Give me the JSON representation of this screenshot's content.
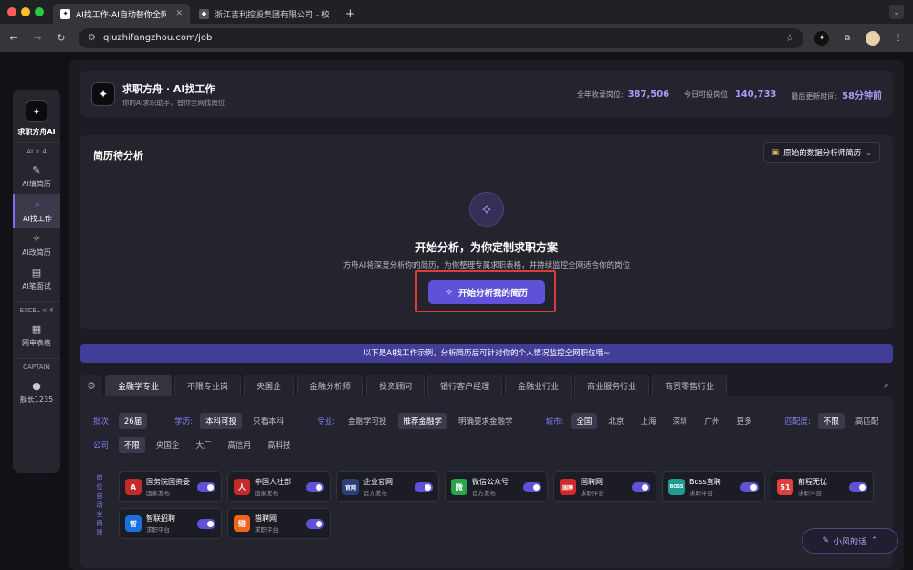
{
  "browser": {
    "tabs": [
      {
        "title": "AI找工作-AI自动替你全网找工作",
        "active": true
      },
      {
        "title": "浙江吉利控股集团有限公司 - 校",
        "active": false
      }
    ],
    "url": "qiuzhifangzhou.com/job"
  },
  "sidebar": {
    "brand": "求职方舟AI",
    "section_ai": "AI × 4",
    "items": [
      {
        "label": "AI填简历",
        "icon": "edit-icon"
      },
      {
        "label": "AI找工作",
        "icon": "search-icon",
        "active": true
      },
      {
        "label": "AI改简历",
        "icon": "magic-wand-icon"
      },
      {
        "label": "AI笔面试",
        "icon": "id-card-icon"
      }
    ],
    "section_excel": "EXCEL × 4",
    "excel_item": "网申表格",
    "section_captain": "CAPTAIN",
    "user": "舰长1235"
  },
  "header": {
    "title": "求职方舟 · AI找工作",
    "subtitle": "你的AI求职助手，替你全网找岗位",
    "stats": [
      {
        "label": "全年收录岗位:",
        "value": "387,506"
      },
      {
        "label": "今日可投岗位:",
        "value": "140,733"
      },
      {
        "label": "最后更新时间:",
        "value": "58分钟前"
      }
    ]
  },
  "resume": {
    "title": "简历待分析",
    "selector": "原始的数据分析师简历",
    "heading": "开始分析，为你定制求职方案",
    "sub": "方舟AI将深度分析你的简历，为你整理专属求职表格，并持续监控全网适合你的岗位",
    "cta": "开始分析我的简历"
  },
  "banner": "以下是AI找工作示例，分析简历后可针对你的个人情况监控全网职位哦~",
  "categories": [
    "金融学专业",
    "不限专业岗",
    "央国企",
    "金融分析师",
    "投资顾问",
    "银行客户经理",
    "金融业行业",
    "商业服务行业",
    "商贸零售行业"
  ],
  "filters": {
    "batch": {
      "label": "批次:",
      "options": [
        "26届"
      ]
    },
    "degree": {
      "label": "学历:",
      "options": [
        "本科可投",
        "只看本科"
      ]
    },
    "major": {
      "label": "专业:",
      "options": [
        "金融学可投",
        "推荐金融学",
        "明确要求金融学"
      ]
    },
    "city": {
      "label": "城市:",
      "options": [
        "全国",
        "北京",
        "上海",
        "深圳",
        "广州",
        "更多"
      ]
    },
    "match": {
      "label": "匹配度:",
      "options": [
        "不限",
        "高匹配"
      ]
    },
    "company": {
      "label": "公司:",
      "options": [
        "不限",
        "央国企",
        "大厂",
        "高信用",
        "高科技"
      ]
    }
  },
  "sources_label": "岗位自动全网搜",
  "sources": [
    {
      "name": "国务院国资委",
      "sub": "国家发布",
      "color": "#c42a2a",
      "glyph": "A"
    },
    {
      "name": "中国人社部",
      "sub": "国家发布",
      "color": "#c42a2a",
      "glyph": "人"
    },
    {
      "name": "企业官网",
      "sub": "官方发布",
      "color": "#2b3f7a",
      "glyph": "官网"
    },
    {
      "name": "微信公众号",
      "sub": "官方发布",
      "color": "#26a54a",
      "glyph": "微"
    },
    {
      "name": "国聘网",
      "sub": "求职平台",
      "color": "#d02b2b",
      "glyph": "国聘"
    },
    {
      "name": "Boss直聘",
      "sub": "求职平台",
      "color": "#1f9c8f",
      "glyph": "BOSS"
    },
    {
      "name": "前程无忧",
      "sub": "求职平台",
      "color": "#e23f3f",
      "glyph": "51"
    },
    {
      "name": "智联招聘",
      "sub": "求职平台",
      "color": "#1c6fe0",
      "glyph": "智"
    },
    {
      "name": "猎聘网",
      "sub": "求职平台",
      "color": "#f0641e",
      "glyph": "猎"
    }
  ],
  "chat": "小风的话"
}
